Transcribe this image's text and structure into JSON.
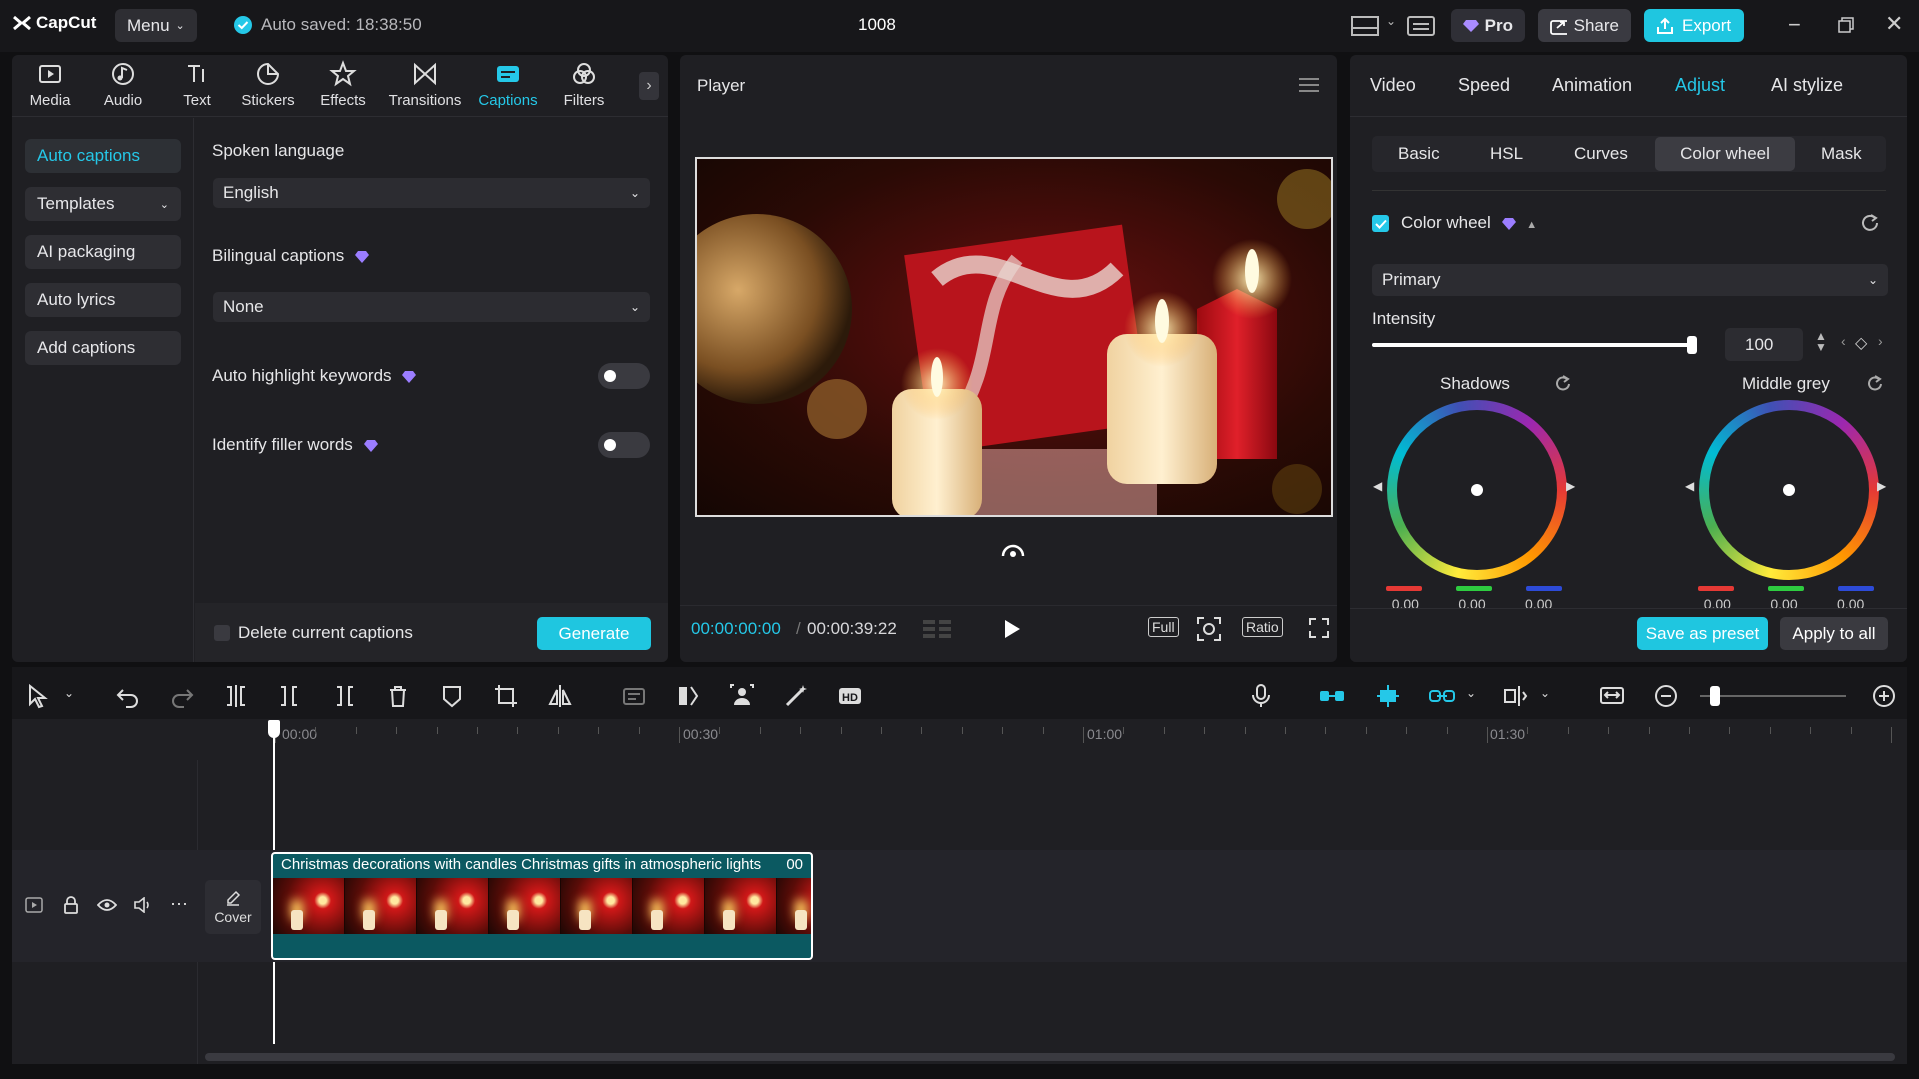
{
  "app": {
    "logo": "CapCut",
    "menu": "Menu",
    "autosave": "Auto saved: 18:38:50",
    "project": "1008"
  },
  "titlebar": {
    "pro": "Pro",
    "share": "Share",
    "export": "Export"
  },
  "tabs": [
    {
      "label": "Media",
      "icon": "media-icon"
    },
    {
      "label": "Audio",
      "icon": "audio-icon"
    },
    {
      "label": "Text",
      "icon": "text-icon"
    },
    {
      "label": "Stickers",
      "icon": "stickers-icon"
    },
    {
      "label": "Effects",
      "icon": "effects-icon"
    },
    {
      "label": "Transitions",
      "icon": "transitions-icon"
    },
    {
      "label": "Captions",
      "icon": "captions-icon"
    },
    {
      "label": "Filters",
      "icon": "filters-icon"
    }
  ],
  "captions_nav": [
    "Auto captions",
    "Templates",
    "AI packaging",
    "Auto lyrics",
    "Add captions"
  ],
  "captions_form": {
    "spoken_language_label": "Spoken language",
    "spoken_language_value": "English",
    "bilingual_label": "Bilingual captions",
    "bilingual_value": "None",
    "highlight_label": "Auto highlight keywords",
    "filler_label": "Identify filler words",
    "delete_label": "Delete current captions",
    "generate": "Generate"
  },
  "player": {
    "title": "Player",
    "current_time": "00:00:00:00",
    "duration": "00:00:39:22",
    "full": "Full",
    "ratio": "Ratio"
  },
  "inspector": {
    "tabs": [
      "Video",
      "Speed",
      "Animation",
      "Adjust",
      "AI stylize"
    ],
    "subtabs": [
      "Basic",
      "HSL",
      "Curves",
      "Color wheel",
      "Mask"
    ],
    "section_title": "Color wheel",
    "mode": "Primary",
    "intensity_label": "Intensity",
    "intensity_value": "100",
    "intensity_level": 1.0,
    "wheels": [
      {
        "label": "Shadows",
        "values": [
          "0.00",
          "0.00",
          "0.00"
        ]
      },
      {
        "label": "Middle grey",
        "values": [
          "0.00",
          "0.00",
          "0.00"
        ]
      }
    ],
    "save_preset": "Save as preset",
    "apply_all": "Apply to all"
  },
  "timeline": {
    "ruler": [
      "00:00",
      "00:30",
      "01:00",
      "01:30"
    ],
    "clip_title": "Christmas decorations with candles Christmas gifts in atmospheric lights",
    "clip_time": "00",
    "cover": "Cover"
  },
  "colors": {
    "accent": "#25c8e8",
    "panel": "#1f1f23",
    "background": "#101012"
  }
}
